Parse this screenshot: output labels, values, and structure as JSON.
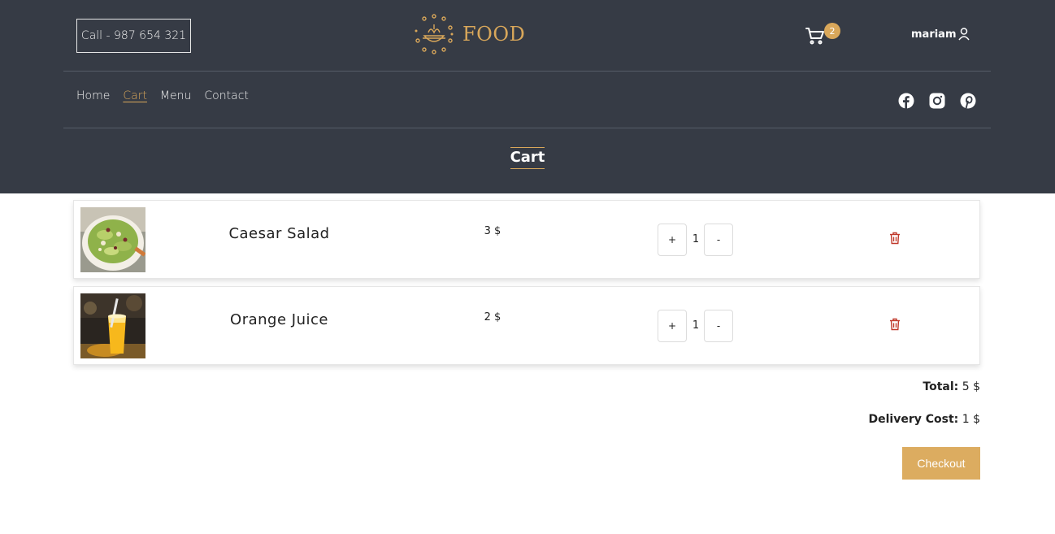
{
  "header": {
    "call_label": "Call - 987 654 321",
    "logo_text": "FOOD",
    "cart_count": "2",
    "username": "mariam"
  },
  "nav": {
    "items": [
      {
        "label": "Home",
        "active": false
      },
      {
        "label": "Cart",
        "active": true
      },
      {
        "label": "Menu",
        "active": false
      },
      {
        "label": "Contact",
        "active": false
      }
    ]
  },
  "social": [
    "facebook-icon",
    "instagram-icon",
    "pinterest-icon"
  ],
  "page_title": "Cart",
  "cart": {
    "items": [
      {
        "name": "Caesar Salad",
        "price": "3 $",
        "quantity": "1",
        "plus": "+",
        "minus": "-"
      },
      {
        "name": "Orange Juice",
        "price": "2 $",
        "quantity": "1",
        "plus": "+",
        "minus": "-"
      }
    ],
    "total_label": "Total:",
    "total_value": "5 $",
    "delivery_label": "Delivery Cost:",
    "delivery_value": "1 $",
    "checkout_label": "Checkout"
  },
  "colors": {
    "header_bg": "#363b45",
    "accent": "#d9a75a",
    "delete": "#c0392b"
  }
}
